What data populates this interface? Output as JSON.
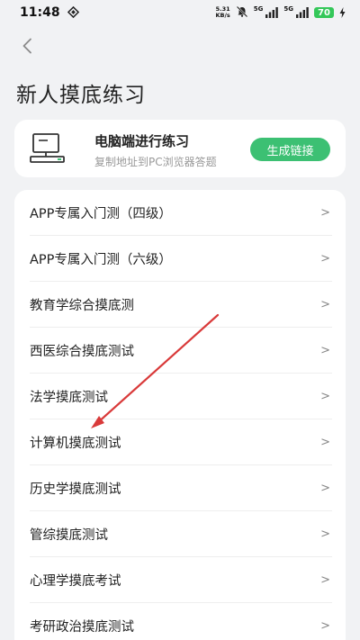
{
  "status": {
    "time": "11:48",
    "speed_value": "5.31",
    "speed_unit": "KB/s",
    "net1": "5G",
    "net2": "5G",
    "battery": "70"
  },
  "page": {
    "title": "新人摸底练习"
  },
  "pc_card": {
    "title": "电脑端进行练习",
    "subtitle": "复制地址到PC浏览器答题",
    "button": "生成链接"
  },
  "list": {
    "items": [
      {
        "label": "APP专属入门测（四级）"
      },
      {
        "label": "APP专属入门测（六级）"
      },
      {
        "label": "教育学综合摸底测"
      },
      {
        "label": "西医综合摸底测试"
      },
      {
        "label": "法学摸底测试"
      },
      {
        "label": "计算机摸底测试"
      },
      {
        "label": "历史学摸底测试"
      },
      {
        "label": "管综摸底测试"
      },
      {
        "label": "心理学摸底考试"
      },
      {
        "label": "考研政治摸底测试"
      }
    ],
    "chevron": ">"
  },
  "colors": {
    "accent": "#3cc073",
    "annotation_arrow": "#d93a3a"
  }
}
